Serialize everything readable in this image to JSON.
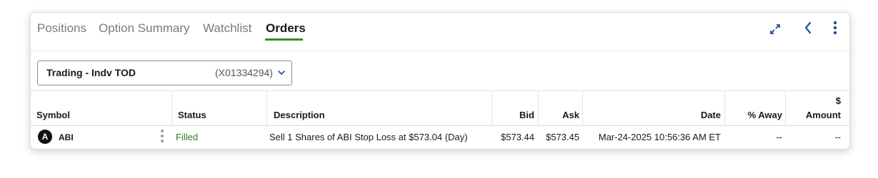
{
  "tabs": [
    {
      "label": "Positions",
      "active": false
    },
    {
      "label": "Option Summary",
      "active": false
    },
    {
      "label": "Watchlist",
      "active": false
    },
    {
      "label": "Orders",
      "active": true
    }
  ],
  "toolbar_icons": [
    "expand-icon",
    "chevron-left-icon",
    "more-vertical-icon"
  ],
  "account": {
    "name": "Trading - Indv TOD",
    "id": "(X01334294)"
  },
  "table": {
    "columns": {
      "symbol": "Symbol",
      "status": "Status",
      "description": "Description",
      "bid": "Bid",
      "ask": "Ask",
      "date": "Date",
      "away": "% Away",
      "amount_currency": "$",
      "amount": "Amount"
    },
    "rows": [
      {
        "badge": "A",
        "symbol": "ABI",
        "status": "Filled",
        "description": "Sell 1 Shares of ABI Stop Loss at $573.04 (Day)",
        "bid": "$573.44",
        "ask": "$573.45",
        "date": "Mar-24-2025 10:56:36 AM ET",
        "away": "--",
        "amount": "--"
      }
    ]
  },
  "colors": {
    "accent_green": "#3a8a2a",
    "status_filled": "#2e7d1e",
    "icon_blue": "#1f4fa0"
  }
}
